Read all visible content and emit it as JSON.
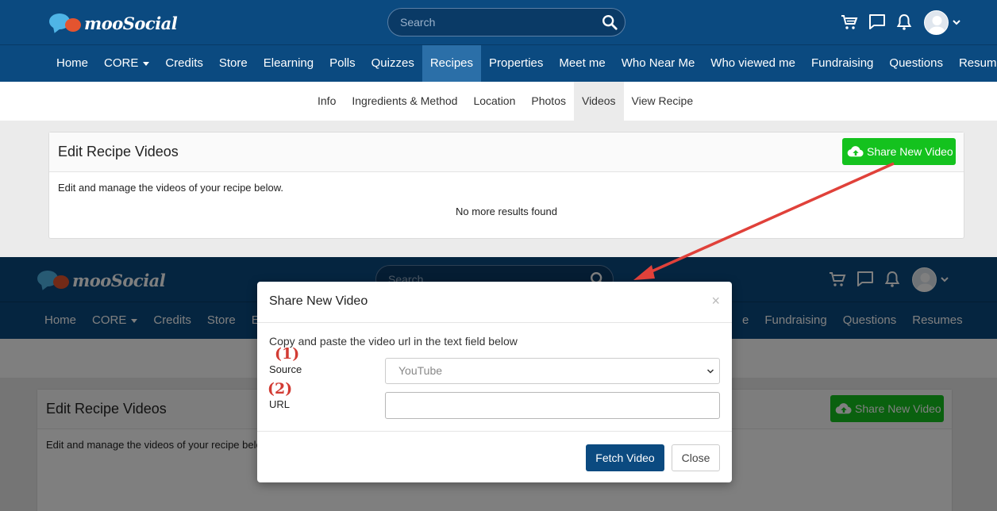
{
  "brand": {
    "name": "mooSocial"
  },
  "search": {
    "placeholder": "Search"
  },
  "nav": {
    "core_label": "CORE",
    "items": [
      "Home",
      "CORE",
      "Credits",
      "Store",
      "Elearning",
      "Polls",
      "Quizzes",
      "Recipes",
      "Properties",
      "Meet me",
      "Who Near Me",
      "Who viewed me",
      "Fundraising",
      "Questions",
      "Resumes"
    ],
    "active": "Recipes"
  },
  "subnav": {
    "items": [
      "Info",
      "Ingredients & Method",
      "Location",
      "Photos",
      "Videos",
      "View Recipe"
    ],
    "active": "Videos"
  },
  "card": {
    "title": "Edit Recipe Videos",
    "share_button": "Share New Video",
    "description": "Edit and manage the videos of your recipe below.",
    "empty": "No more results found"
  },
  "bottom": {
    "search_placeholder": "Search",
    "nav_left": [
      "Home",
      "CORE",
      "Credits",
      "Store",
      "Elea"
    ],
    "nav_right": [
      "e",
      "Fundraising",
      "Questions",
      "Resumes"
    ],
    "card_desc": "Edit and manage the videos of your recipe belo"
  },
  "modal": {
    "title": "Share New Video",
    "close_symbol": "×",
    "instruction": "Copy and paste the video url in the text field below",
    "source_label": "Source",
    "source_value": "YouTube",
    "url_label": "URL",
    "url_value": "",
    "fetch_button": "Fetch Video",
    "close_button": "Close",
    "marker1": "(1)",
    "marker2": "(2)"
  },
  "colors": {
    "header": "#0b4a80",
    "nav_active": "#2b6fa8",
    "share_green": "#14c21e",
    "arrow_red": "#e0413a",
    "marker_red": "#d23b33"
  }
}
